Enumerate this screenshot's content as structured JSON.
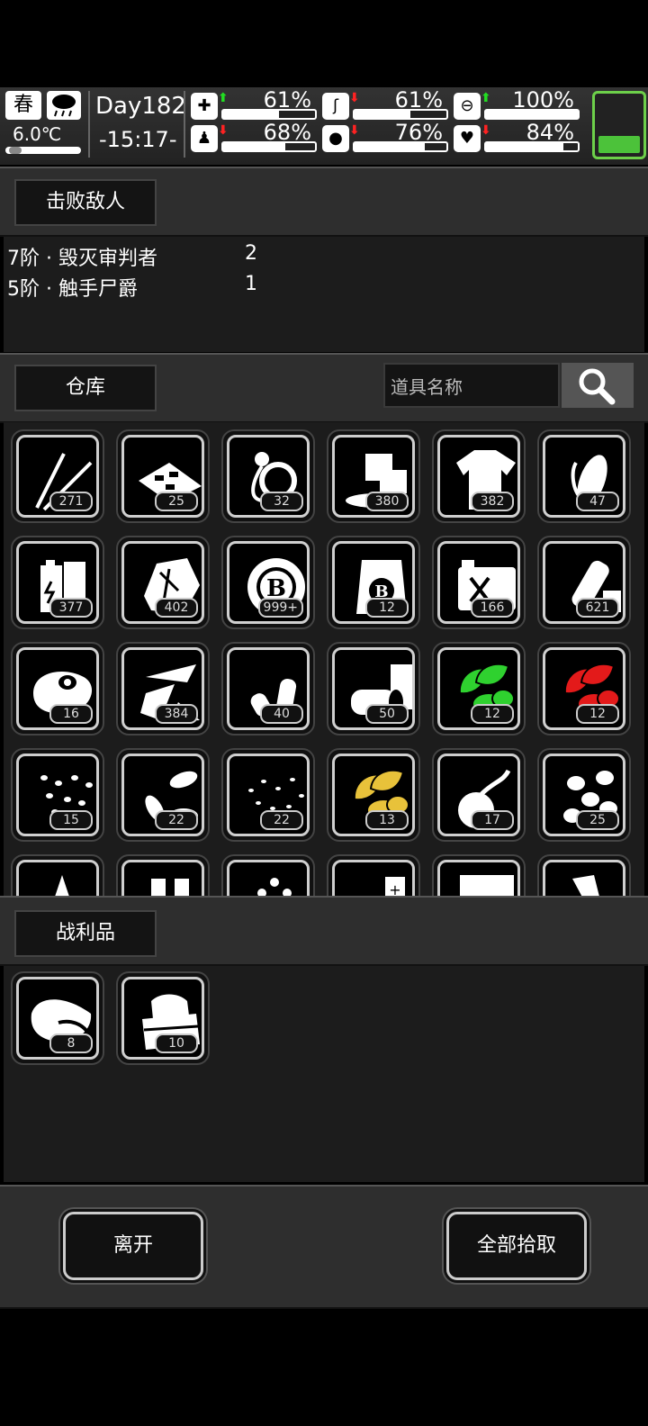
{
  "status": {
    "season": "春",
    "temperature": "6.0℃",
    "day": "Day182",
    "time": "-15:17-",
    "stats": [
      {
        "icon": "medkit-icon",
        "trend": "up",
        "value": "61%",
        "fill": 0.61
      },
      {
        "icon": "stomach-icon",
        "trend": "down",
        "value": "61%",
        "fill": 0.61
      },
      {
        "icon": "pill-icon",
        "trend": "up",
        "value": "100%",
        "fill": 1.0
      },
      {
        "icon": "foot-icon",
        "trend": "down",
        "value": "68%",
        "fill": 0.68
      },
      {
        "icon": "water-drop-icon",
        "trend": "down",
        "value": "76%",
        "fill": 0.76
      },
      {
        "icon": "heart-icon",
        "trend": "down",
        "value": "84%",
        "fill": 0.84
      }
    ],
    "battery_fill": 0.3,
    "colors": {
      "up": "#22dd22",
      "down": "#ff2222",
      "battery": "#4cc23a"
    }
  },
  "defeated": {
    "title": "击败敌人",
    "enemies": [
      {
        "name": "7阶 · 毁灭审判者",
        "count": "2"
      },
      {
        "name": "5阶 · 触手尸爵",
        "count": "1"
      }
    ]
  },
  "warehouse": {
    "title": "仓库",
    "search_placeholder": "道具名称",
    "items": [
      {
        "icon": "tweezers-icon",
        "count": "271"
      },
      {
        "icon": "fabric-pieces-icon",
        "count": "25"
      },
      {
        "icon": "rope-icon",
        "count": "32"
      },
      {
        "icon": "ice-block-icon",
        "count": "380"
      },
      {
        "icon": "torn-shirt-icon",
        "count": "382"
      },
      {
        "icon": "corn-icon",
        "count": "47"
      },
      {
        "icon": "battery-icon",
        "count": "377"
      },
      {
        "icon": "crumpled-paper-icon",
        "count": "402"
      },
      {
        "icon": "coin-icon",
        "count": "999+"
      },
      {
        "icon": "coin-bag-icon",
        "count": "12"
      },
      {
        "icon": "fuel-can-icon",
        "count": "166"
      },
      {
        "icon": "plastic-bottle-icon",
        "count": "621"
      },
      {
        "icon": "raw-meat-icon",
        "count": "16"
      },
      {
        "icon": "glass-shard-icon",
        "count": "384"
      },
      {
        "icon": "bullets-icon",
        "count": "40"
      },
      {
        "icon": "cans-icon",
        "count": "50"
      },
      {
        "icon": "green-leaves-icon",
        "count": "12"
      },
      {
        "icon": "red-leaves-icon",
        "count": "12"
      },
      {
        "icon": "beans-icon",
        "count": "15"
      },
      {
        "icon": "seeds-icon",
        "count": "22"
      },
      {
        "icon": "small-seeds-icon",
        "count": "22"
      },
      {
        "icon": "yellow-leaves-icon",
        "count": "13"
      },
      {
        "icon": "onion-icon",
        "count": "17"
      },
      {
        "icon": "mushroom-icon",
        "count": "25"
      },
      {
        "icon": "partial-item-icon",
        "count": ""
      },
      {
        "icon": "bottles-icon",
        "count": ""
      },
      {
        "icon": "pellets-icon",
        "count": ""
      },
      {
        "icon": "battery-cell-icon",
        "count": ""
      },
      {
        "icon": "cloth-roll-icon",
        "count": ""
      },
      {
        "icon": "tool-icon",
        "count": ""
      }
    ]
  },
  "loot": {
    "title": "战利品",
    "items": [
      {
        "icon": "meat-chunk-icon",
        "count": "8"
      },
      {
        "icon": "folded-cloth-icon",
        "count": "10"
      }
    ]
  },
  "actions": {
    "leave": "离开",
    "take_all": "全部拾取"
  },
  "leaf_colors": {
    "green": "#2fd12f",
    "red": "#e31a1a",
    "yellow": "#e8c23a"
  }
}
